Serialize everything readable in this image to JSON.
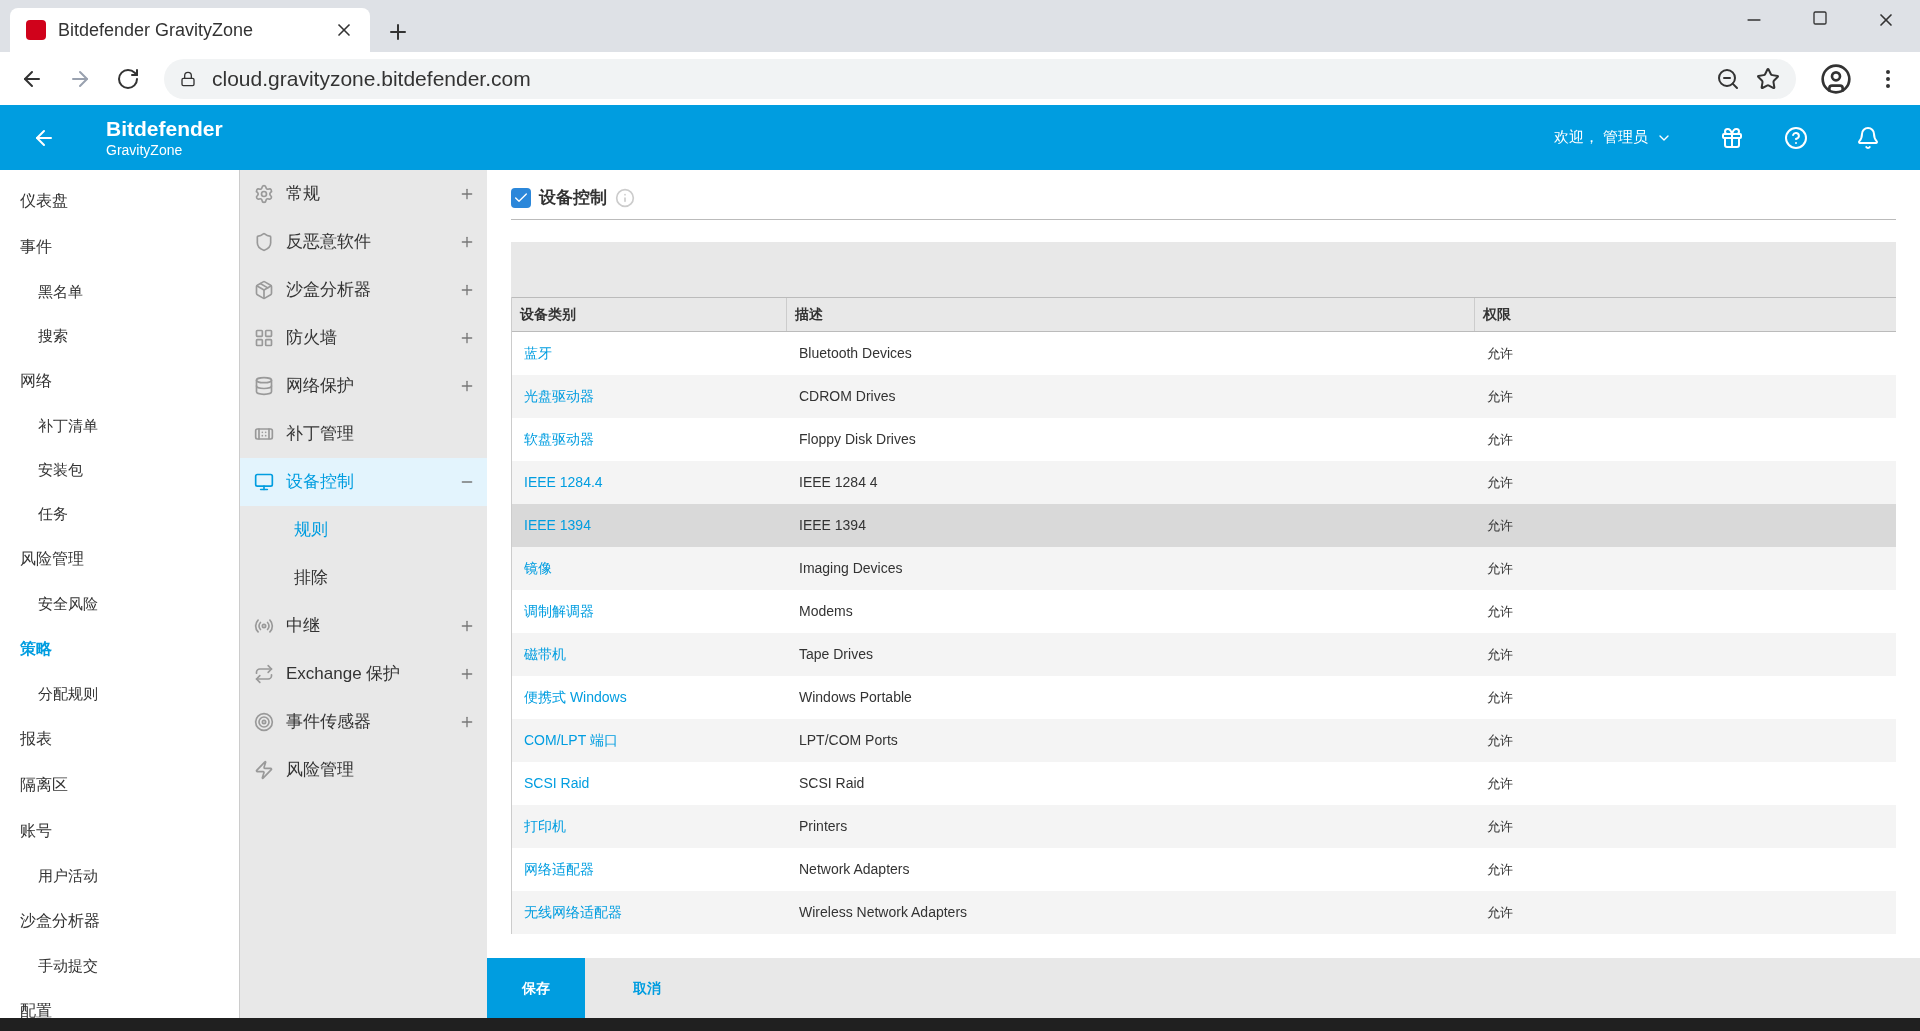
{
  "browser": {
    "tab_title": "Bitdefender GravityZone",
    "url": "cloud.gravityzone.bitdefender.com"
  },
  "header": {
    "brand": "Bitdefender",
    "product": "GravityZone",
    "welcome": "欢迎，",
    "user": "管理员"
  },
  "nav": [
    {
      "label": "仪表盘",
      "selected": false
    },
    {
      "label": "事件",
      "selected": false,
      "children": [
        {
          "label": "黑名单",
          "selected": false
        },
        {
          "label": "搜索",
          "selected": false
        }
      ]
    },
    {
      "label": "网络",
      "selected": false,
      "children": [
        {
          "label": "补丁清单",
          "selected": false
        },
        {
          "label": "安装包",
          "selected": false
        },
        {
          "label": "任务",
          "selected": false
        }
      ]
    },
    {
      "label": "风险管理",
      "selected": false,
      "children": [
        {
          "label": "安全风险",
          "selected": false
        }
      ]
    },
    {
      "label": "策略",
      "selected": true,
      "children": [
        {
          "label": "分配规则",
          "selected": false
        }
      ]
    },
    {
      "label": "报表",
      "selected": false
    },
    {
      "label": "隔离区",
      "selected": false
    },
    {
      "label": "账号",
      "selected": false,
      "children": [
        {
          "label": "用户活动",
          "selected": false
        }
      ]
    },
    {
      "label": "沙盒分析器",
      "selected": false,
      "children": [
        {
          "label": "手动提交",
          "selected": false
        }
      ]
    },
    {
      "label": "配置",
      "selected": false
    }
  ],
  "policy_sections": [
    {
      "label": "常规",
      "expanded": false,
      "selected": false
    },
    {
      "label": "反恶意软件",
      "expanded": false,
      "selected": false
    },
    {
      "label": "沙盒分析器",
      "expanded": false,
      "selected": false
    },
    {
      "label": "防火墙",
      "expanded": false,
      "selected": false
    },
    {
      "label": "网络保护",
      "expanded": false,
      "selected": false
    },
    {
      "label": "补丁管理",
      "selected": false
    },
    {
      "label": "设备控制",
      "expanded": true,
      "selected": true,
      "children": [
        {
          "label": "规则",
          "selected": true
        },
        {
          "label": "排除",
          "selected": false
        }
      ]
    },
    {
      "label": "中继",
      "expanded": false,
      "selected": false
    },
    {
      "label": "Exchange 保护",
      "expanded": false,
      "selected": false
    },
    {
      "label": "事件传感器",
      "expanded": false,
      "selected": false
    },
    {
      "label": "风险管理",
      "selected": false
    }
  ],
  "device_control": {
    "label": "设备控制",
    "checked": true
  },
  "table": {
    "columns": [
      "设备类别",
      "描述",
      "权限"
    ],
    "rows": [
      {
        "category": "蓝牙",
        "description": "Bluetooth Devices",
        "permission": "允许",
        "highlighted": false
      },
      {
        "category": "光盘驱动器",
        "description": "CDROM Drives",
        "permission": "允许",
        "highlighted": false
      },
      {
        "category": "软盘驱动器",
        "description": "Floppy Disk Drives",
        "permission": "允许",
        "highlighted": false
      },
      {
        "category": "IEEE 1284.4",
        "description": "IEEE 1284 4",
        "permission": "允许",
        "highlighted": false
      },
      {
        "category": "IEEE 1394",
        "description": "IEEE 1394",
        "permission": "允许",
        "highlighted": true
      },
      {
        "category": "镜像",
        "description": "Imaging Devices",
        "permission": "允许",
        "highlighted": false
      },
      {
        "category": "调制解调器",
        "description": "Modems",
        "permission": "允许",
        "highlighted": false
      },
      {
        "category": "磁带机",
        "description": "Tape Drives",
        "permission": "允许",
        "highlighted": false
      },
      {
        "category": "便携式 Windows",
        "description": "Windows Portable",
        "permission": "允许",
        "highlighted": false
      },
      {
        "category": "COM/LPT 端口",
        "description": "LPT/COM Ports",
        "permission": "允许",
        "highlighted": false
      },
      {
        "category": "SCSI Raid",
        "description": "SCSI Raid",
        "permission": "允许",
        "highlighted": false
      },
      {
        "category": "打印机",
        "description": "Printers",
        "permission": "允许",
        "highlighted": false
      },
      {
        "category": "网络适配器",
        "description": "Network Adapters",
        "permission": "允许",
        "highlighted": false
      },
      {
        "category": "无线网络适配器",
        "description": "Wireless Network Adapters",
        "permission": "允许",
        "highlighted": false
      }
    ]
  },
  "buttons": [
    {
      "label": "保存",
      "kind": "primary"
    },
    {
      "label": "取消",
      "kind": "link"
    }
  ]
}
